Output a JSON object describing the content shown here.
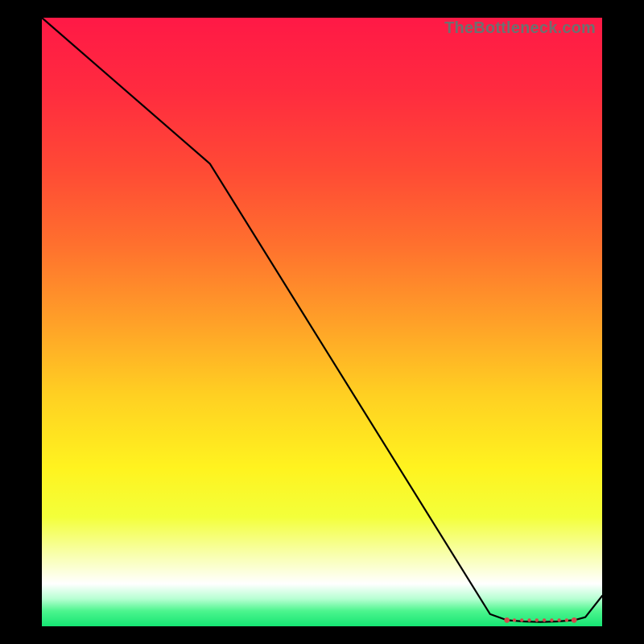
{
  "watermark": "TheBottleneck.com",
  "chart_data": {
    "type": "line",
    "title": "",
    "xlabel": "",
    "ylabel": "",
    "xlim": [
      0,
      100
    ],
    "ylim": [
      0,
      100
    ],
    "x": [
      0,
      25,
      30,
      80,
      83,
      86,
      89,
      92,
      95,
      97,
      100
    ],
    "values": [
      100,
      80,
      76,
      2,
      1,
      0.8,
      0.7,
      0.8,
      1,
      1.5,
      5
    ],
    "marker_range": {
      "x_start": 83,
      "x_end": 95,
      "y": 1
    },
    "gradient_stops": [
      {
        "offset": 0.0,
        "color": "#ff1946"
      },
      {
        "offset": 0.12,
        "color": "#ff2b3f"
      },
      {
        "offset": 0.25,
        "color": "#ff4a35"
      },
      {
        "offset": 0.37,
        "color": "#ff6f2e"
      },
      {
        "offset": 0.5,
        "color": "#ffa028"
      },
      {
        "offset": 0.62,
        "color": "#ffd022"
      },
      {
        "offset": 0.74,
        "color": "#fff31f"
      },
      {
        "offset": 0.82,
        "color": "#f3ff3a"
      },
      {
        "offset": 0.88,
        "color": "#f8ffa9"
      },
      {
        "offset": 0.93,
        "color": "#ffffff"
      },
      {
        "offset": 0.955,
        "color": "#b6ffd2"
      },
      {
        "offset": 0.975,
        "color": "#4cf58e"
      },
      {
        "offset": 1.0,
        "color": "#15e573"
      }
    ]
  }
}
